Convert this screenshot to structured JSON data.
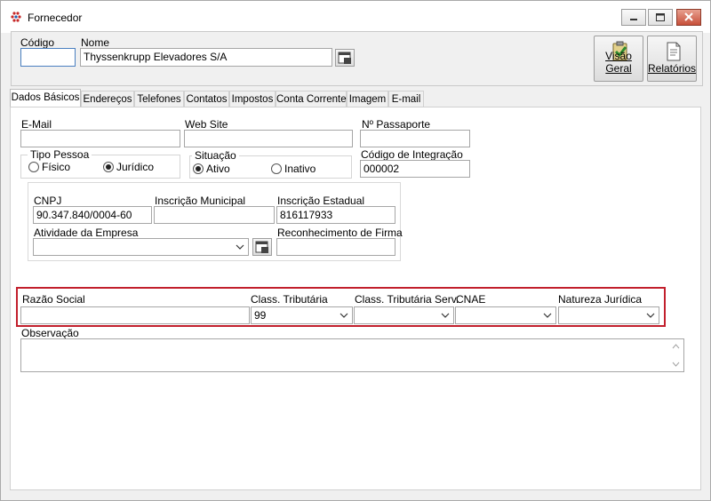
{
  "window": {
    "title": "Fornecedor"
  },
  "header": {
    "codigo_label": "Código",
    "codigo_value": "",
    "nome_label": "Nome",
    "nome_value": "Thyssenkrupp Elevadores S/A",
    "visao_geral_label": "Visão Geral",
    "relatorios_label": "Relatórios"
  },
  "tabs": [
    {
      "label": "Dados Básicos"
    },
    {
      "label": "Endereços"
    },
    {
      "label": "Telefones"
    },
    {
      "label": "Contatos"
    },
    {
      "label": "Impostos"
    },
    {
      "label": "Conta Corrente"
    },
    {
      "label": "Imagem"
    },
    {
      "label": "E-mail"
    }
  ],
  "basic": {
    "email_label": "E-Mail",
    "email_value": "",
    "website_label": "Web Site",
    "website_value": "",
    "passaporte_label": "Nº Passaporte",
    "passaporte_value": "",
    "tipo_pessoa_label": "Tipo Pessoa",
    "fisico_label": "Físico",
    "juridico_label": "Jurídico",
    "tipo_pessoa_selected": "Jurídico",
    "situacao_label": "Situação",
    "ativo_label": "Ativo",
    "inativo_label": "Inativo",
    "situacao_selected": "Ativo",
    "codigo_integracao_label": "Código de Integração",
    "codigo_integracao_value": "000002"
  },
  "company": {
    "cnpj_label": "CNPJ",
    "cnpj_value": "90.347.840/0004-60",
    "inscricao_municipal_label": "Inscrição Municipal",
    "inscricao_municipal_value": "",
    "inscricao_estadual_label": "Inscrição Estadual",
    "inscricao_estadual_value": "816117933",
    "atividade_label": "Atividade da Empresa",
    "atividade_value": "",
    "reconhecimento_label": "Reconhecimento de Firma",
    "reconhecimento_value": ""
  },
  "tax": {
    "razao_social_label": "Razão Social",
    "razao_social_value": "",
    "class_tributaria_label": "Class. Tributária",
    "class_tributaria_value": "99",
    "class_tributaria_serv_label": "Class. Tributária Serv.",
    "class_tributaria_serv_value": "",
    "cnae_label": "CNAE",
    "cnae_value": "",
    "natureza_juridica_label": "Natureza Jurídica",
    "natureza_juridica_value": ""
  },
  "obs": {
    "label": "Observação",
    "value": ""
  },
  "colors": {
    "highlight_border": "#c21f2c",
    "field_focus_border": "#4a7fc0",
    "close_button": "#c7503a"
  }
}
